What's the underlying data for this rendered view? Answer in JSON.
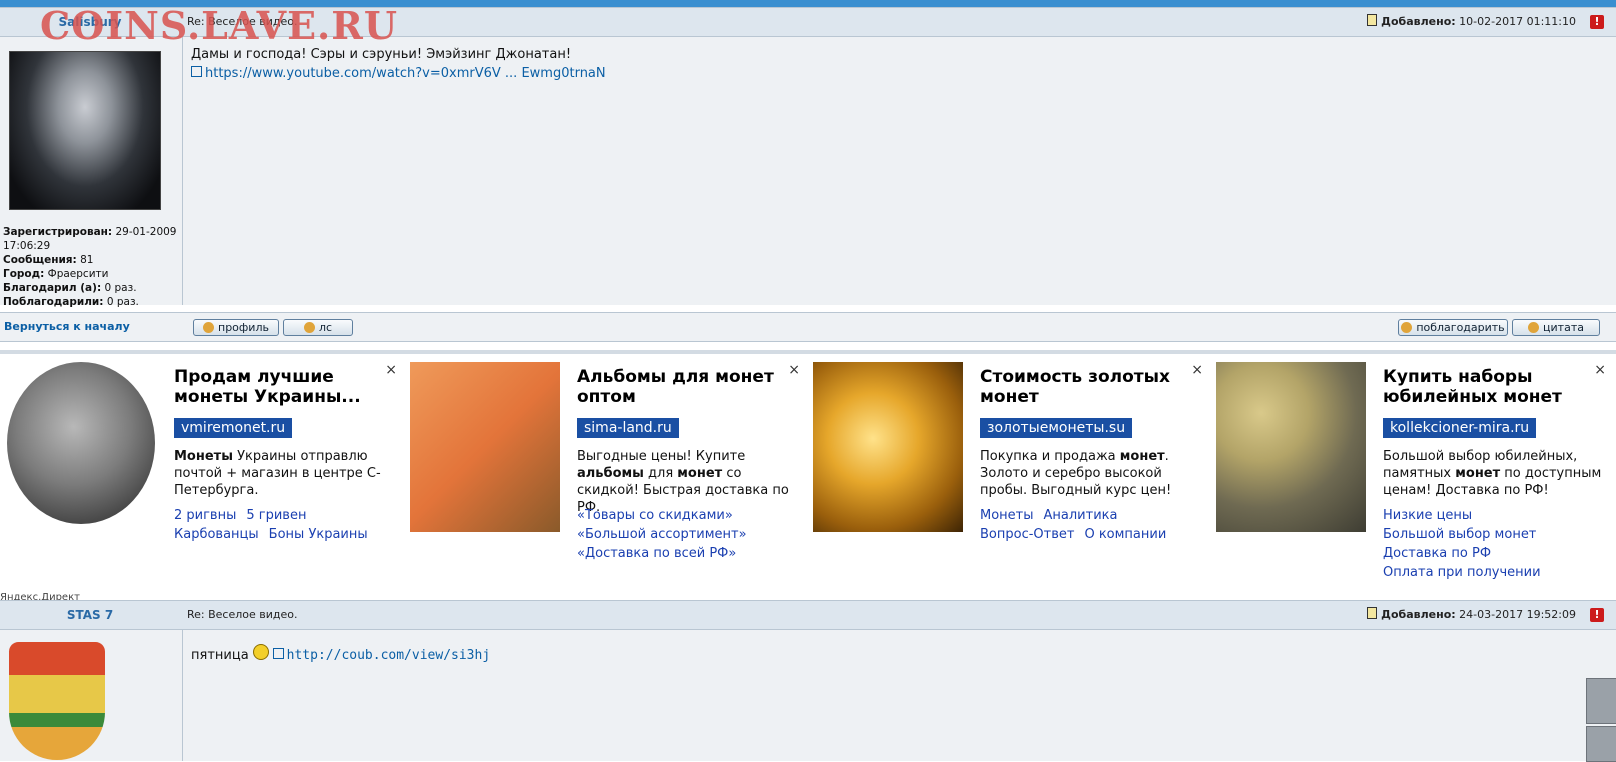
{
  "watermark": "COINS.LAVE.RU",
  "post1": {
    "author": "Salisbury",
    "subject": "Re: Веселое видео.",
    "added_label": "Добавлено:",
    "added_date": "10-02-2017 01:11:10",
    "text": "Дамы и господа! Сэры и сэруньи! Эмэйзинг Джонатан!",
    "link": "https://www.youtube.com/watch?v=0xmrV6V ... Ewmg0trnaN",
    "info": {
      "registered_label": "Зарегистрирован:",
      "registered_value": "29-01-2009 17:06:29",
      "messages_label": "Сообщения:",
      "messages_value": "81",
      "city_label": "Город:",
      "city_value": "Фраерсити",
      "thanked_label": "Благодарил (а):",
      "thanked_value": "0 раз.",
      "was_thanked_label": "Поблагодарили:",
      "was_thanked_value": "0 раз."
    }
  },
  "footer": {
    "back": "Вернуться к началу",
    "profile": "профиль",
    "pm": "лс",
    "thank": "поблагодарить",
    "quote": "цитата"
  },
  "ads": [
    {
      "title": "Продам лучшие монеты Украины...",
      "domain": "vmiremonet.ru",
      "text_bold": "Монеты",
      "text": " Украины отправлю почтой + магазин в центре С-Петербурга.",
      "links": [
        "2 ригвны",
        "5 гривен",
        "Карбованцы",
        "Боны Украины"
      ],
      "image": "coin-crab-image"
    },
    {
      "title": "Альбомы для монет оптом",
      "domain": "sima-land.ru",
      "text_a": "Выгодные цены! Купите ",
      "text_b": "альбомы",
      "text_c": " для ",
      "text_d": "монет",
      "text_e": " со скидкой! Быстрая доставка по РФ.",
      "links": [
        "«Товары со скидками»",
        "«Большой ассортимент»",
        "«Доставка по всей РФ»"
      ],
      "image": "coin-album-image"
    },
    {
      "title": "Стоимость золотых монет",
      "domain": "золотыемонеты.su",
      "text_a": "Покупка и продажа ",
      "text_b": "монет",
      "text_c": ". Золото и серебро высокой пробы. Выгодный курс цен!",
      "links": [
        "Монеты",
        "Аналитика",
        "Вопрос-Ответ",
        "О компании"
      ],
      "image": "gold-coins-image"
    },
    {
      "title": "Купить наборы юбилейных монет",
      "domain": "kollekcioner-mira.ru",
      "text_a": "Большой выбор юбилейных, памятных ",
      "text_b": "монет",
      "text_c": " по доступным ценам! Доставка по РФ!",
      "links": [
        "Низкие цены",
        "Большой выбор монет",
        "Доставка по РФ",
        "Оплата при получении"
      ],
      "image": "coin-sets-image"
    }
  ],
  "ad_close": "×",
  "yandex": "Яндекс.Директ",
  "post2": {
    "author": "STAS 7",
    "subject": "Re: Веселое видео.",
    "added_label": "Добавлено:",
    "added_date": "24-03-2017 19:52:09",
    "text": "пятница",
    "link": "http://coub.com/view/si3hj"
  }
}
